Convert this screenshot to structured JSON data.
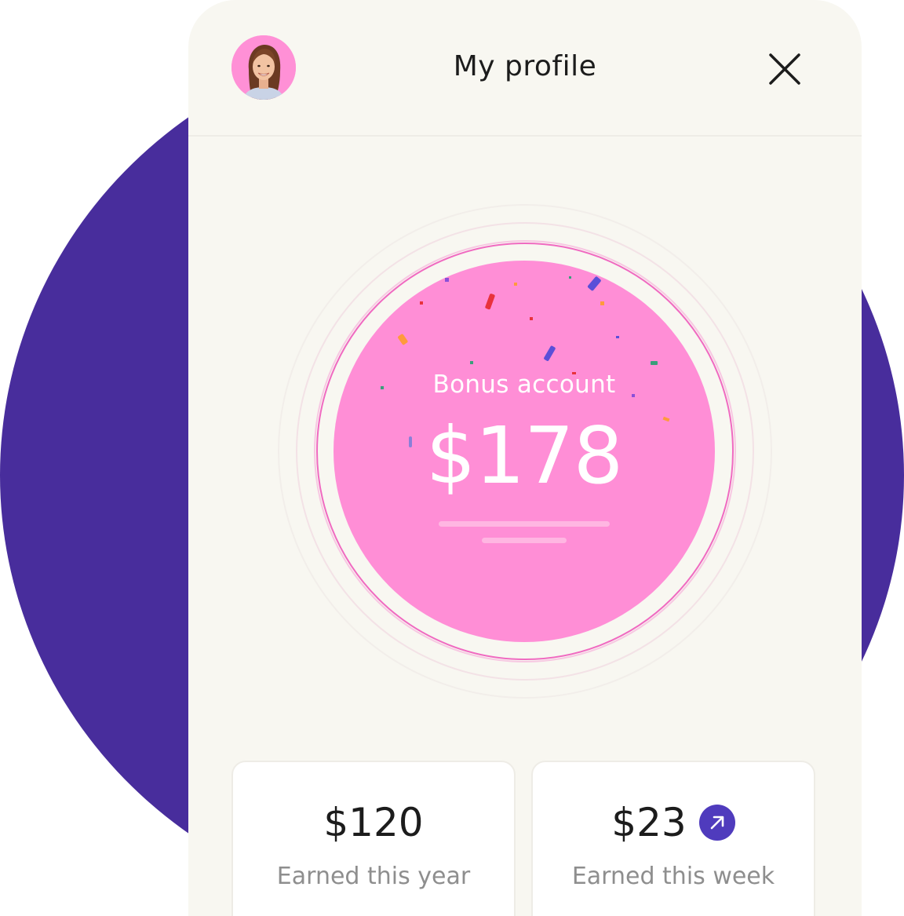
{
  "header": {
    "title": "My profile",
    "avatar_icon": "avatar-photo",
    "close_icon": "close-icon"
  },
  "bonus": {
    "label": "Bonus account",
    "amount": "$178"
  },
  "stats": [
    {
      "value": "$120",
      "caption": "Earned this year"
    },
    {
      "value": "$23",
      "caption": "Earned this week",
      "icon": "arrow-up-right-icon"
    }
  ],
  "colors": {
    "background_circle": "#482d9c",
    "panel": "#f8f7f1",
    "bonus_circle": "#ff8ed6",
    "accent_ring": "#f06ac1",
    "trend_icon": "#4f3bbd"
  }
}
